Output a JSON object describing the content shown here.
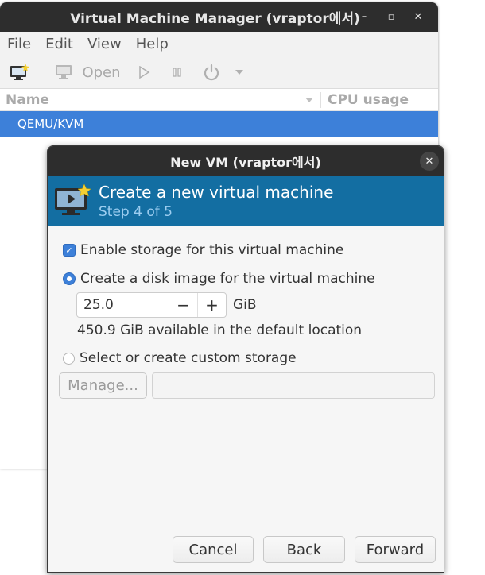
{
  "main_window": {
    "title": "Virtual Machine Manager (vraptor에서)",
    "controls": {
      "minimize": "–",
      "maximize": "▫",
      "close": "✕"
    },
    "menu": [
      "File",
      "Edit",
      "View",
      "Help"
    ],
    "toolbar": {
      "open_label": "Open"
    },
    "list_columns": {
      "name": "Name",
      "cpu": "CPU usage"
    },
    "connections": [
      "QEMU/KVM"
    ]
  },
  "dialog": {
    "title": "New VM (vraptor에서)",
    "close": "✕",
    "header_title": "Create a new virtual machine",
    "header_step": "Step 4 of 5",
    "enable_storage_label": "Enable storage for this virtual machine",
    "enable_storage_checked": true,
    "create_disk_label": "Create a disk image for the virtual machine",
    "disk_size_value": "25.0",
    "disk_unit": "GiB",
    "available_text": "450.9 GiB available in the default location",
    "custom_storage_label": "Select or create custom storage",
    "manage_label": "Manage...",
    "custom_path_value": "",
    "buttons": {
      "cancel": "Cancel",
      "back": "Back",
      "forward": "Forward"
    }
  },
  "colors": {
    "accent": "#3d80d9",
    "banner": "#136ea2",
    "titlebar": "#2d2d2d"
  }
}
